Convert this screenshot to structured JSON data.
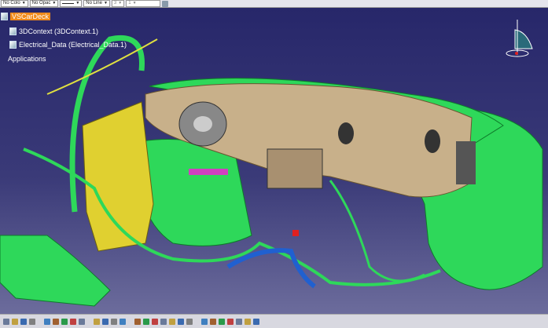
{
  "toolbar_top": {
    "color": "No Colo",
    "opacity": "No Opac",
    "linetype": "No Line",
    "thickness": "3",
    "layer": "1"
  },
  "tree": {
    "root": "VSCarDeck",
    "children": [
      "3DContext (3DContext.1)",
      "Electrical_Data (Electrical_Data.1)"
    ],
    "applications": "Applications"
  },
  "colors": {
    "background_top": "#27276a",
    "background_bottom": "#6c6c9c",
    "harness": "#2ed85a",
    "dashboard": "#c8b08a",
    "selection": "#f08a1a"
  },
  "bottom_toolbar": {
    "icons": [
      "new-icon",
      "open-icon",
      "save-icon",
      "print-icon",
      "cut-icon",
      "copy-icon",
      "paste-icon",
      "undo-icon",
      "help-icon",
      "formula-icon",
      "search-icon",
      "catalog-icon",
      "measure-icon",
      "pan-icon",
      "rotate-icon",
      "zoom-in-icon",
      "zoom-out-icon",
      "normal-view-icon",
      "iso-view-icon",
      "render-icon",
      "hide-show-icon",
      "harness-icon",
      "connector-icon",
      "bundle-icon",
      "analysis-icon",
      "settings-icon",
      "delete-icon"
    ]
  }
}
